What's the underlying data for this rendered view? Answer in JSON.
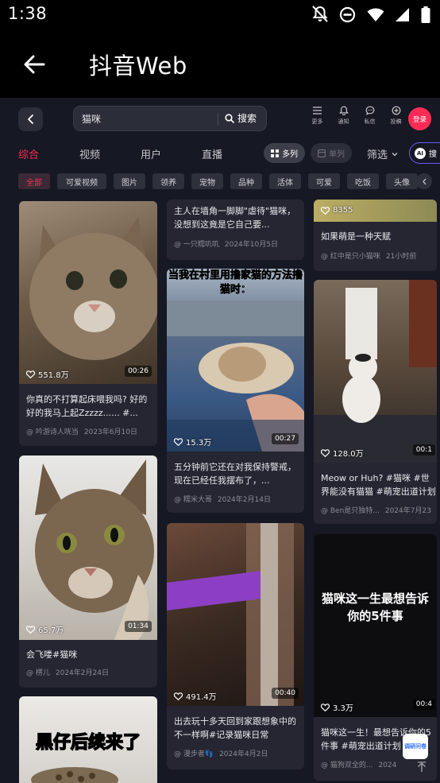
{
  "status_bar": {
    "time": "1:38"
  },
  "app_bar": {
    "title": "抖音Web"
  },
  "search": {
    "query": "猫咪",
    "button_label": "搜索"
  },
  "nav": [
    {
      "label": "更多",
      "icon": "menu-icon"
    },
    {
      "label": "通知",
      "icon": "bell-icon"
    },
    {
      "label": "私信",
      "icon": "message-icon"
    },
    {
      "label": "投稿",
      "icon": "upload-icon"
    }
  ],
  "login_label": "登录",
  "tabs": [
    "综合",
    "视频",
    "用户",
    "直播"
  ],
  "view_multi_label": "多列",
  "view_single_label": "单列",
  "filter_label": "筛选",
  "ai_search_label": "搜",
  "ai_badge": "AI",
  "chips": [
    "全部",
    "可爱视频",
    "图片",
    "领养",
    "宠物",
    "品种",
    "活体",
    "可爱",
    "吃饭",
    "头像"
  ],
  "cards": [
    {
      "likes": "551.8万",
      "duration": "00:26",
      "title": "你真的不打算起床喂我吗? 好的好的我马上起Zzzzz...... #...",
      "author": "@ 吟游诗人咣当",
      "date": "2023年6月10日"
    },
    {
      "likes": "65.7万",
      "duration": "01:34",
      "title": "会飞喽#猫咪",
      "author": "@ 楞儿",
      "date": "2024年2月24日"
    },
    {
      "overlay": "黑仔后续来了"
    },
    {
      "title": "主人在墙角一脚脚\"虐待\"猫咪，没想到这竟是它自己要...",
      "author": "@ 一只糯叽叽",
      "date": "2024年10月5日"
    },
    {
      "overlay": "当我在村里用撸家猫的方法撸猫时：",
      "likes": "15.3万",
      "duration": "00:27",
      "title": "五分钟前它还在对我保持警戒，现在已经任我摆布了，...",
      "author": "@ 糯米大哥",
      "date": "2024年2月14日"
    },
    {
      "likes": "491.4万",
      "duration": "00:40",
      "title": "出去玩十多天回到家跟想象中的不一样啊#记录猫咪日常",
      "author": "@ 漫步者👣",
      "date": "2024年4月2日"
    },
    {
      "likes": "8355",
      "title": "如果萌是一种天赋",
      "author": "@ 红中是只小猫咪",
      "date": "21小时前"
    },
    {
      "likes": "128.0万",
      "duration": "00:1",
      "title": "Meow or Huh? #猫咪 #世界能没有猫猫 #萌宠出道计划",
      "author": "@ Ben是只独特...",
      "date": "2024年7月23"
    },
    {
      "overlay": "猫咪这一生最想告诉你的5件事",
      "likes": "3.3万",
      "duration": "00:4",
      "title": "猫咪这一生！最想告诉你的5件事 #萌宠出道计划 #猫咪...",
      "author": "@ 猫狗双全的...",
      "date": "2024"
    }
  ],
  "float_button": "调研问卷"
}
